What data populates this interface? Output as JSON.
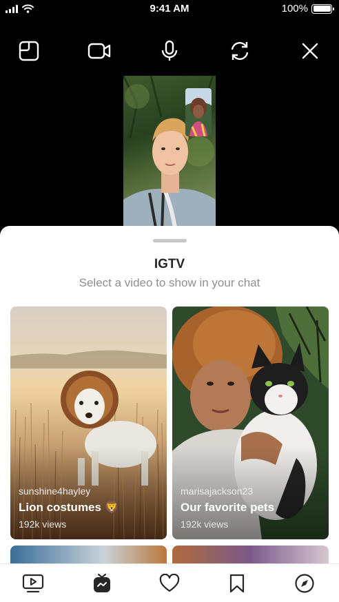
{
  "status_bar": {
    "time": "9:41 AM",
    "battery": "100%"
  },
  "toolbar": {
    "icons": [
      "media-layout-icon",
      "video-camera-icon",
      "microphone-icon",
      "flip-camera-icon",
      "close-icon"
    ]
  },
  "sheet": {
    "title": "IGTV",
    "subtitle": "Select a video to show in your chat",
    "videos": [
      {
        "username": "sunshine4hayley",
        "title": "Lion costumes",
        "emoji": "🦁",
        "views": "192k views"
      },
      {
        "username": "marisajackson23",
        "title": "Our favorite pets",
        "emoji": "",
        "views": "192k views"
      }
    ]
  },
  "tabbar": {
    "icons": [
      "igtv-icon",
      "igtv-app-icon",
      "heart-icon",
      "bookmark-icon",
      "explore-compass-icon"
    ]
  },
  "colors": {
    "sheet_bg": "#ffffff",
    "title": "#262626",
    "subtitle": "#8e8e8e",
    "icon_dark": "#262626"
  }
}
